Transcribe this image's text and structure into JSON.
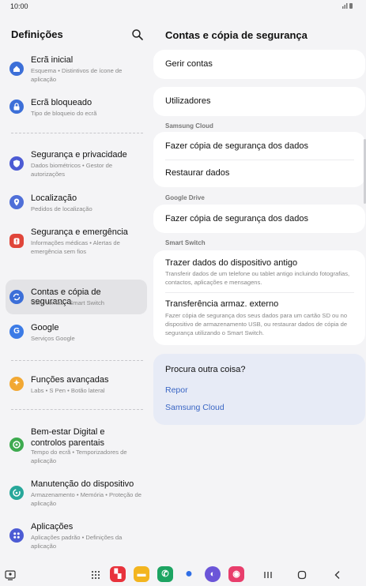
{
  "status_bar": {
    "time": "10:00",
    "icons": [
      "signal-icon",
      "battery-icon"
    ]
  },
  "left_panel": {
    "title": "Definições",
    "search_icon": "search-icon",
    "items": [
      {
        "title": "Ecrã inicial",
        "subtitle": "Esquema • Distintivos de ícone de aplicação",
        "icon": "home-icon",
        "color": "#3c6fd8"
      },
      {
        "title": "Ecrã bloqueado",
        "subtitle": "Tipo de bloqueio do ecrã",
        "icon": "lock-icon",
        "color": "#3c6fd8"
      },
      {
        "title": "Segurança e privacidade",
        "subtitle": "Dados biométricos • Gestor de autorizações",
        "icon": "shield-icon",
        "color": "#4c5bd4"
      },
      {
        "title": "Localização",
        "subtitle": "Pedidos de localização",
        "icon": "location-icon",
        "color": "#4f6fd8"
      },
      {
        "title": "Segurança e emergência",
        "subtitle": "Informações médicas • Alertas de emergência sem fios",
        "icon": "emergency-icon",
        "color": "#e0453a"
      },
      {
        "title": "Contas e cópia de segurança",
        "subtitle": "Gerir contas • Smart Switch",
        "icon": "sync-icon",
        "color": "#3c6fd8"
      },
      {
        "title": "Google",
        "subtitle": "Serviços Google",
        "icon": "google-icon",
        "color": "#3c7be6"
      },
      {
        "title": "Funções avançadas",
        "subtitle": "Labs • S Pen • Botão lateral",
        "icon": "star-gear-icon",
        "color": "#f2a833"
      },
      {
        "title": "Bem-estar Digital e controlos parentais",
        "subtitle": "Tempo do ecrã • Temporizadores de aplicação",
        "icon": "wellbeing-icon",
        "color": "#3daa4f"
      },
      {
        "title": "Manutenção do dispositivo",
        "subtitle": "Armazenamento • Memória • Proteção de aplicação",
        "icon": "maintenance-icon",
        "color": "#27a79a"
      },
      {
        "title": "Aplicações",
        "subtitle": "Aplicações padrão • Definições da aplicação",
        "icon": "apps-icon",
        "color": "#4c5bd4"
      }
    ]
  },
  "right_panel": {
    "title": "Contas e cópia de segurança",
    "manage_accounts": "Gerir contas",
    "users": "Utilizadores",
    "samsung_cloud_header": "Samsung Cloud",
    "backup_data": "Fazer cópia de segurança dos dados",
    "restore_data": "Restaurar dados",
    "google_drive_header": "Google Drive",
    "google_backup": "Fazer cópia de segurança dos dados",
    "smart_switch_header": "Smart Switch",
    "bring_data_title": "Trazer dados do dispositivo antigo",
    "bring_data_sub": "Transferir dados de um telefone ou tablet antigo incluindo fotografias, contactos, aplicações e mensagens.",
    "external_title": "Transferência armaz. externo",
    "external_sub": "Fazer cópia de segurança dos seus dados para um cartão SD ou no dispositivo de armazenamento USB, ou restaurar dados de cópia de segurança utilizando o Smart Switch.",
    "looking_for": "Procura outra coisa?",
    "reset_link": "Repor",
    "samsung_cloud_link": "Samsung Cloud"
  },
  "nav_bar": {
    "left_icon": "screen-capture-icon",
    "apps": [
      {
        "name": "app-drawer-icon",
        "color": "#444444"
      },
      {
        "name": "flipboard-icon",
        "color": "#e8323c",
        "glyph": "▚"
      },
      {
        "name": "files-icon",
        "color": "#f3b51f",
        "glyph": "▬"
      },
      {
        "name": "phone-icon",
        "color": "#1da462",
        "glyph": "✆"
      },
      {
        "name": "messages-icon",
        "color": "#2f6ee6",
        "glyph": "●"
      },
      {
        "name": "internet-icon",
        "color": "#6b55d8",
        "glyph": "◐"
      },
      {
        "name": "camera-icon",
        "color": "#e83e6c",
        "glyph": "◉"
      }
    ],
    "system": [
      "recents-icon",
      "home-icon",
      "back-icon"
    ]
  }
}
